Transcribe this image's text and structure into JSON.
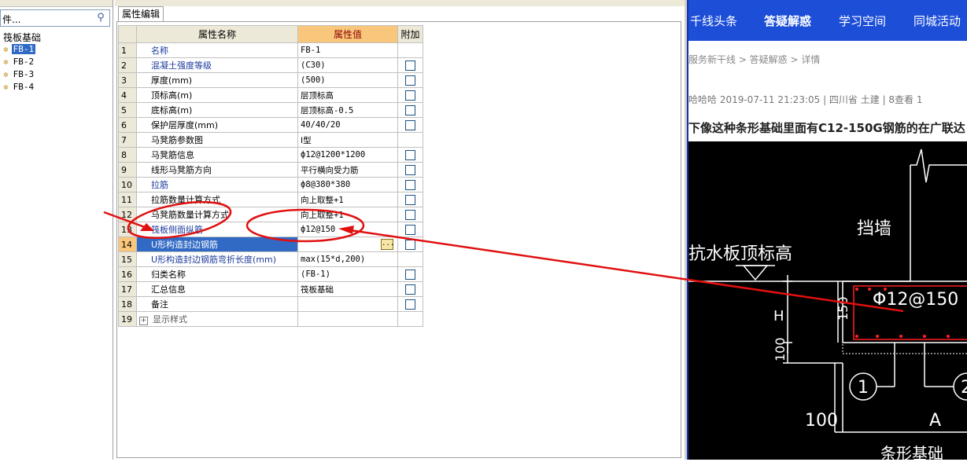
{
  "left_panel": {
    "search_value": "件...",
    "search_icon": "search-icon",
    "tree_root": "筏板基础",
    "items": [
      {
        "label": "FB-1",
        "selected": true
      },
      {
        "label": "FB-2",
        "selected": false
      },
      {
        "label": "FB-3",
        "selected": false
      },
      {
        "label": "FB-4",
        "selected": false
      }
    ]
  },
  "prop_panel": {
    "tab_label": "属性编辑",
    "headers": {
      "name": "属性名称",
      "value": "属性值",
      "extra": "附加"
    },
    "rows": [
      {
        "num": "1",
        "name": "名称",
        "value": "FB-1",
        "check": false
      },
      {
        "num": "2",
        "name": "混凝土强度等级",
        "value": "(C30)",
        "check": true
      },
      {
        "num": "3",
        "name": "厚度(mm)",
        "value": "(500)",
        "check": true
      },
      {
        "num": "4",
        "name": "顶标高(m)",
        "value": "层顶标高",
        "check": true
      },
      {
        "num": "5",
        "name": "底标高(m)",
        "value": "层顶标高-0.5",
        "check": true
      },
      {
        "num": "6",
        "name": "保护层厚度(mm)",
        "value": "40/40/20",
        "check": true
      },
      {
        "num": "7",
        "name": "马凳筋参数图",
        "value": "Ⅰ型",
        "check": false
      },
      {
        "num": "8",
        "name": "马凳筋信息",
        "value": "ф12@1200*1200",
        "check": true
      },
      {
        "num": "9",
        "name": "线形马凳筋方向",
        "value": "平行横向受力筋",
        "check": true
      },
      {
        "num": "10",
        "name": "拉筋",
        "value": "ф8@380*380",
        "check": true
      },
      {
        "num": "11",
        "name": "拉筋数量计算方式",
        "value": "向上取整+1",
        "check": true
      },
      {
        "num": "12",
        "name": "马凳筋数量计算方式",
        "value": "向上取整+1",
        "check": true
      },
      {
        "num": "13",
        "name": "筏板侧面纵筋",
        "value": "ф12@150",
        "check": true
      },
      {
        "num": "14",
        "name": "U形构造封边钢筋",
        "value": "",
        "check": true
      },
      {
        "num": "15",
        "name": "U形构造封边钢筋弯折长度(mm)",
        "value": "max(15*d,200)",
        "check": false
      },
      {
        "num": "16",
        "name": "归类名称",
        "value": "(FB-1)",
        "check": true
      },
      {
        "num": "17",
        "name": "汇总信息",
        "value": "筏板基础",
        "check": true
      },
      {
        "num": "18",
        "name": "备注",
        "value": "",
        "check": true
      },
      {
        "num": "19",
        "name": "显示样式",
        "value": "",
        "check": false
      }
    ],
    "more_button": "..."
  },
  "right_panel": {
    "nav": [
      "千线头条",
      "答疑解惑",
      "学习空间",
      "同城活动"
    ],
    "nav_active": "答疑解惑",
    "breadcrumb": "服务新干线 > 答疑解惑 > 详情",
    "meta": "哈哈哈   2019-07-11 21:23:05   |   四川省 土建   |   8查看 1",
    "title": "下像这种条形基础里面有C12-150G钢筋的在广联达",
    "cad_labels": {
      "wall": "挡墙",
      "slab_top": "抗水板顶标高",
      "rebar": "Φ12@150",
      "h": "H",
      "d150": "150",
      "d100a": "100",
      "d100b": "100",
      "circle1": "1",
      "circle2": "2",
      "a": "A",
      "bottom": "条形基础"
    }
  },
  "colors": {
    "nav_blue": "#1d4ed8",
    "selection_blue": "#316ac5",
    "header_orange": "#f9c77b",
    "annotation_red": "#e01010",
    "cad_red": "#ff2020"
  }
}
